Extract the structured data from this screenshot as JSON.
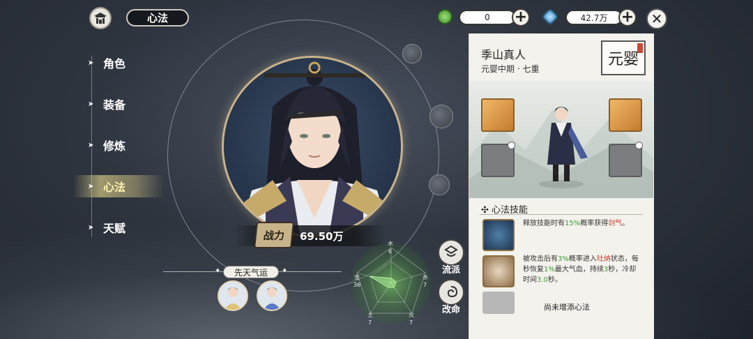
{
  "top_bar": {
    "home_icon": "temple-icon",
    "title": "心法",
    "currency1": {
      "icon": "jade-coin-icon",
      "value": "0"
    },
    "currency2": {
      "icon": "spirit-stone-icon",
      "value": "42.7万"
    },
    "plus": "+",
    "close": "✕"
  },
  "nav": {
    "items": [
      {
        "label": "角色"
      },
      {
        "label": "装备"
      },
      {
        "label": "修炼"
      },
      {
        "label": "心法",
        "active": true
      },
      {
        "label": "天赋"
      }
    ]
  },
  "hero": {
    "power_label": "战力",
    "power_value": "69.50万",
    "fortune_label": "先天气运"
  },
  "radar": {
    "labels": [
      "木",
      "水",
      "火",
      "土",
      "金"
    ],
    "values": [
      "6",
      "7",
      "7",
      "7",
      "36"
    ]
  },
  "side_buttons": [
    {
      "label": "流派",
      "icon": "school-icon"
    },
    {
      "label": "改命",
      "icon": "fate-swirl-icon"
    }
  ],
  "panel": {
    "name": "季山真人",
    "realm": "元婴中期 · 七重",
    "realm_seal": "元婴",
    "section_title": "心法技能",
    "skills": [
      {
        "text_pre": "释放技能时有",
        "hl1": "15%",
        "text_mid": "概率获得",
        "hl2": "剑气",
        "text_post": "。"
      },
      {
        "text_pre": "被攻击后有",
        "hl1": "3%",
        "text_mid": "概率进入",
        "hl2": "吐纳",
        "text_post": "状态，每秒恢复",
        "hl3": "1%",
        "text_post2": "最大气血，持续",
        "hl4": "3",
        "text_post3": "秒，冷却时间",
        "hl5": "3.0",
        "text_post4": "秒。"
      }
    ],
    "empty_text": "尚未增添心法"
  },
  "colors": {
    "accent_gold": "#c9b38a",
    "highlight_green": "#3f9a3a",
    "highlight_red": "#c5362a"
  }
}
